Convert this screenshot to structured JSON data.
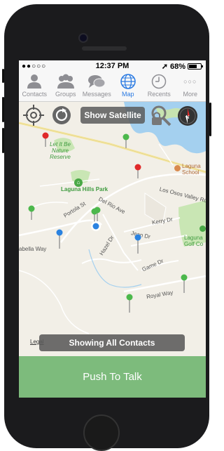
{
  "status": {
    "signal_dots": "●●○○○",
    "time": "12:37 PM",
    "location_arrow": "➚",
    "battery_percent": "68%",
    "battery_level": 0.68
  },
  "tabs": [
    {
      "label": "Contacts",
      "icon": "contacts-person-icon"
    },
    {
      "label": "Groups",
      "icon": "groups-people-icon"
    },
    {
      "label": "Messages",
      "icon": "messages-bubbles-icon"
    },
    {
      "label": "Map",
      "icon": "map-globe-icon",
      "active": true
    },
    {
      "label": "Recents",
      "icon": "recents-clock-icon"
    },
    {
      "label": "More",
      "icon": "more-dots-icon",
      "glyph": "○○○"
    }
  ],
  "map": {
    "show_satellite_label": "Show Satellite",
    "showing_contacts_label": "Showing All Contacts",
    "legal_label": "Legal",
    "places": {
      "nature_reserve": "Let It Be Nature Reserve",
      "park": "Laguna Hills Park",
      "school": "Laguna School",
      "golf": "Laguna Golf Co",
      "compass_letter": "N"
    },
    "streets": {
      "los_osos": "Los Osos Valley Rd",
      "portola": "Portola St",
      "del_rio": "Del Rio Ave",
      "kerry": "Kerry Dr",
      "jean": "Jean Dr",
      "hazel": "Hazel Dr",
      "game": "Game Dr",
      "royal": "Royal Way",
      "isabella": "abella Way"
    },
    "colors": {
      "water": "#a4d0ef",
      "park": "#c9e6b4",
      "pin_red": "#e02a2a",
      "pin_green": "#4cb84c",
      "pin_blue": "#2a82e0"
    }
  },
  "push_to_talk_label": "Push To Talk"
}
